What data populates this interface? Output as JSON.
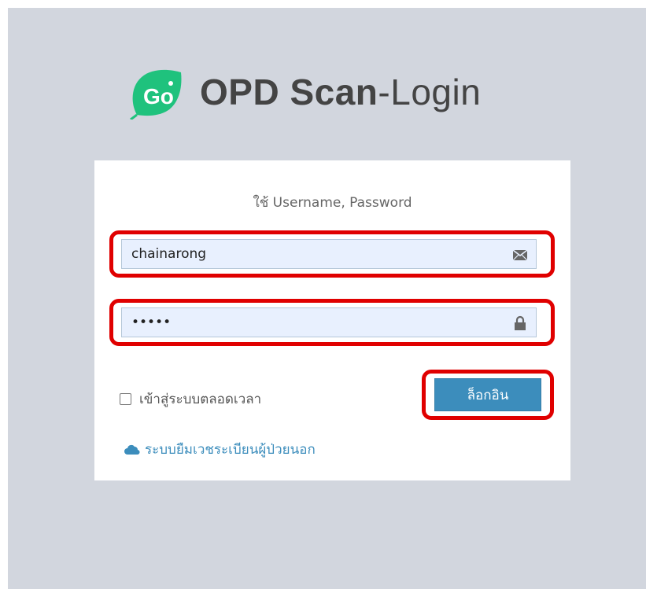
{
  "app": {
    "title_bold": "OPD Scan",
    "title_rest": "-Login",
    "logo_text": "Go"
  },
  "login": {
    "message": "ใช้ Username, Password",
    "username_value": "chainarong",
    "username_icon": "envelope-icon",
    "password_value": "•••••",
    "password_icon": "lock-icon",
    "remember_label": "เข้าสู่ระบบตลอดเวลา",
    "remember_checked": false,
    "submit_label": "ล็อกอิน",
    "link_icon": "cloud-icon",
    "link_label": "ระบบยืมเวชระเบียนผู้ป่วยนอก"
  },
  "colors": {
    "page_bg": "#d2d6de",
    "logo_green": "#1fc27d",
    "button_blue": "#3c8dbc",
    "highlight_red": "#e00000"
  }
}
